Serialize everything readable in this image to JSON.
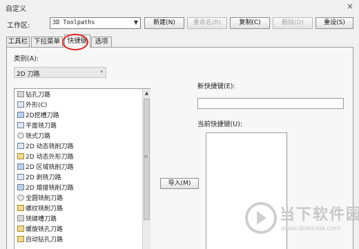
{
  "window": {
    "title": "自定义",
    "close_glyph": "×"
  },
  "workspace": {
    "label": "工作区:",
    "selected": "3D Toolpaths",
    "arrow_glyph": "▼"
  },
  "buttons": [
    {
      "label": "新建(N)",
      "enabled": true
    },
    {
      "label": "重命名(R)",
      "enabled": false
    },
    {
      "label": "复制(C)",
      "enabled": true
    },
    {
      "label": "删除(D)",
      "enabled": false
    },
    {
      "label": "重设(S)",
      "enabled": true
    }
  ],
  "tabs": [
    {
      "label": "工具栏",
      "active": false
    },
    {
      "label": "下拉菜单",
      "active": false
    },
    {
      "label": "快捷键",
      "active": true
    },
    {
      "label": "选项",
      "active": false
    }
  ],
  "category": {
    "label": "类别(A):",
    "selected": "2D 刀路",
    "arrow_glyph": "▾"
  },
  "commands": [
    {
      "label": "钻孔刀路",
      "icon": "drill-icon"
    },
    {
      "label": "外形(C)",
      "icon": "contour-icon"
    },
    {
      "label": "2D挖槽刀路",
      "icon": "pocket-icon"
    },
    {
      "label": "平面铣刀路",
      "icon": "facing-icon"
    },
    {
      "label": "铣式刀路",
      "icon": "gear-icon"
    },
    {
      "label": "2D 动态铣削刀路",
      "icon": "dynamic-mill-icon"
    },
    {
      "label": "2D 动态外形刀路",
      "icon": "dynamic-contour-icon"
    },
    {
      "label": "2D 区域铣削刀路",
      "icon": "area-mill-icon"
    },
    {
      "label": "2D 剥铣刀路",
      "icon": "peel-mill-icon"
    },
    {
      "label": "2D 熔接铣削刀路",
      "icon": "blend-mill-icon"
    },
    {
      "label": "全圆铣削刀路",
      "icon": "circle-mill-icon"
    },
    {
      "label": "螺纹铣削刀路",
      "icon": "thread-mill-icon"
    },
    {
      "label": "铣键槽刀路",
      "icon": "slot-mill-icon"
    },
    {
      "label": "螺旋铣孔刀路",
      "icon": "helix-bore-icon"
    },
    {
      "label": "自动钻孔刀路",
      "icon": "auto-drill-icon"
    }
  ],
  "scrollbar": {
    "up_glyph": "▲",
    "grip_glyph": "≡"
  },
  "import_button": {
    "label": "导入(M)"
  },
  "new_shortcut": {
    "label": "新快捷键(E):",
    "value": ""
  },
  "current_shortcut": {
    "label": "当前快捷键(U):"
  },
  "watermark": {
    "text": "当下软件园",
    "url": "www.downxia.com"
  }
}
